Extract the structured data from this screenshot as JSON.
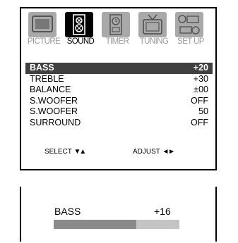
{
  "tabs": [
    {
      "label": "PICTURE",
      "icon": "tv-screen-icon",
      "active": false
    },
    {
      "label": "SOUND",
      "icon": "speaker-icon",
      "active": true
    },
    {
      "label": "TIMER",
      "icon": "timer-icon",
      "active": false
    },
    {
      "label": "TUNING",
      "icon": "antenna-tv-icon",
      "active": false
    },
    {
      "label": "SET UP",
      "icon": "setup-icon",
      "active": false
    }
  ],
  "settings": [
    {
      "name": "BASS",
      "value": "+20",
      "selected": true
    },
    {
      "name": "TREBLE",
      "value": "+30",
      "selected": false
    },
    {
      "name": "BALANCE",
      "value": "±00",
      "selected": false
    },
    {
      "name": "S.WOOFER",
      "value": "OFF",
      "selected": false
    },
    {
      "name": "S.WOOFER",
      "value": "50",
      "selected": false
    },
    {
      "name": "SURROUND",
      "value": "OFF",
      "selected": false
    }
  ],
  "hints": {
    "select_label": "SELECT",
    "select_arrows": "▼▲",
    "adjust_label": "ADJUST",
    "adjust_arrows": "◄ ►"
  },
  "adjustment": {
    "name": "BASS",
    "value": "+16",
    "level_fraction": 0.66
  },
  "colors": {
    "selected_row_bg": "#404040",
    "inactive_tab": "#a9a9a9",
    "active_tab": "#000000",
    "bar_fill": "#8a8a8a",
    "bar_track": "#c4c4c4"
  }
}
